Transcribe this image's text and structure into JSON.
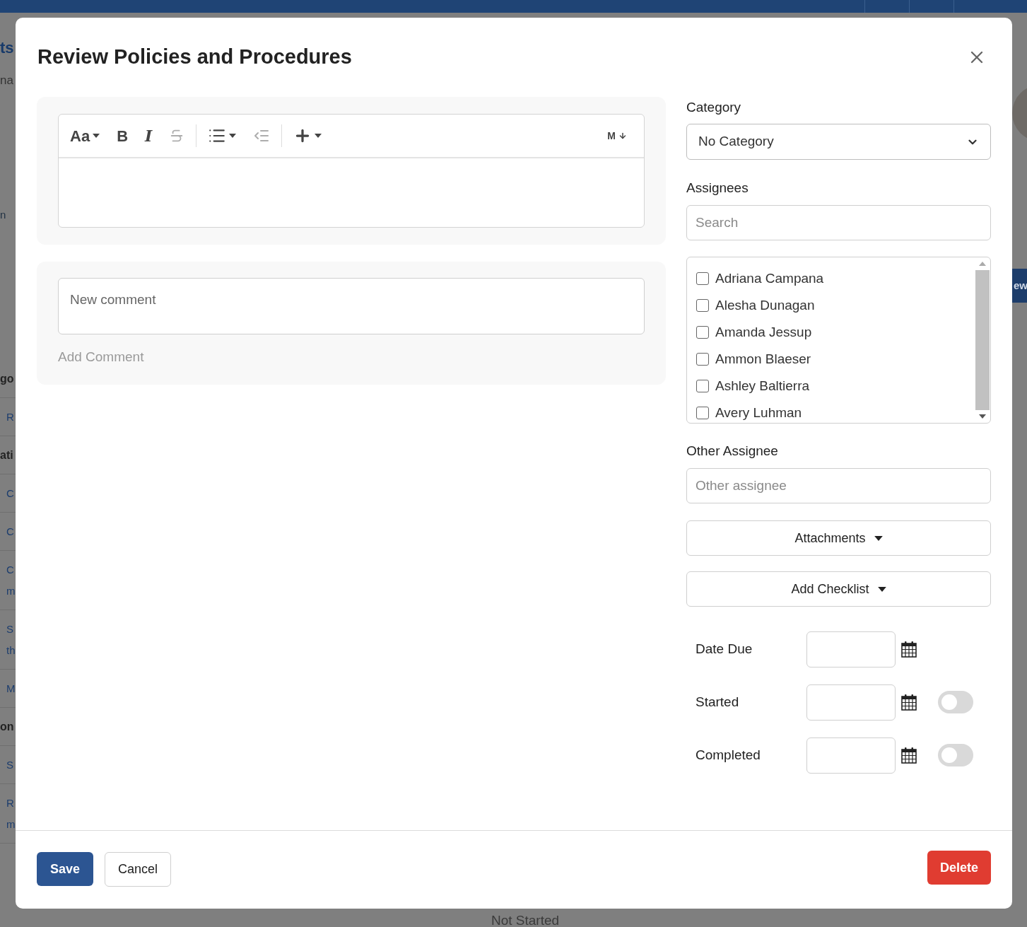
{
  "background": {
    "fragments": [
      {
        "kind": "title",
        "lines": [
          "ts"
        ]
      },
      {
        "kind": "subtitle",
        "lines": [
          "na"
        ]
      },
      {
        "kind": "text",
        "lines": [
          "n"
        ]
      },
      {
        "kind": "section",
        "lines": [
          "go"
        ]
      },
      {
        "kind": "link",
        "lines": [
          "R"
        ]
      },
      {
        "kind": "section",
        "lines": [
          "ati"
        ]
      },
      {
        "kind": "link",
        "lines": [
          "C"
        ]
      },
      {
        "kind": "link",
        "lines": [
          "C"
        ]
      },
      {
        "kind": "link",
        "lines": [
          "C",
          "m"
        ]
      },
      {
        "kind": "link",
        "lines": [
          "S",
          "th"
        ]
      },
      {
        "kind": "link",
        "lines": [
          "M"
        ]
      },
      {
        "kind": "section",
        "lines": [
          "on"
        ]
      },
      {
        "kind": "link",
        "lines": [
          "S"
        ]
      },
      {
        "kind": "link",
        "lines": [
          "R",
          "m"
        ]
      }
    ],
    "row": {
      "status": "Not Started"
    },
    "side_button": "ew"
  },
  "dialog": {
    "title": "Review Policies and Procedures",
    "editor": {
      "toolbar": [
        {
          "kind": "text",
          "label": "Aa",
          "caret": true,
          "disabled": false
        },
        {
          "kind": "bold",
          "label": "B",
          "disabled": false
        },
        {
          "kind": "italic",
          "label": "I",
          "disabled": false
        },
        {
          "kind": "strike",
          "disabled": true
        },
        {
          "kind": "list",
          "caret": true,
          "disabled": false
        },
        {
          "kind": "outdent",
          "disabled": true
        },
        {
          "kind": "plus",
          "caret": true,
          "disabled": false
        },
        {
          "kind": "markdown",
          "label": "M",
          "disabled": false
        }
      ]
    },
    "comment": {
      "placeholder": "New comment",
      "action": "Add Comment"
    },
    "category": {
      "label": "Category",
      "value": "No Category"
    },
    "assignees": {
      "label": "Assignees",
      "search_placeholder": "Search",
      "people": [
        {
          "name": "Adriana Campana",
          "checked": false
        },
        {
          "name": "Alesha Dunagan",
          "checked": false
        },
        {
          "name": "Amanda Jessup",
          "checked": false
        },
        {
          "name": "Ammon Blaeser",
          "checked": false
        },
        {
          "name": "Ashley Baltierra",
          "checked": false
        },
        {
          "name": "Avery Luhman",
          "checked": false
        }
      ]
    },
    "other_assignee": {
      "label": "Other Assignee",
      "placeholder": "Other assignee"
    },
    "dropdown_buttons": [
      "Attachments",
      "Add Checklist"
    ],
    "dates": [
      {
        "label": "Date Due"
      },
      {
        "label": "Started",
        "on": false
      },
      {
        "label": "Completed",
        "on": false
      }
    ],
    "footer": {
      "save": "Save",
      "cancel": "Cancel",
      "delete": "Delete"
    }
  }
}
